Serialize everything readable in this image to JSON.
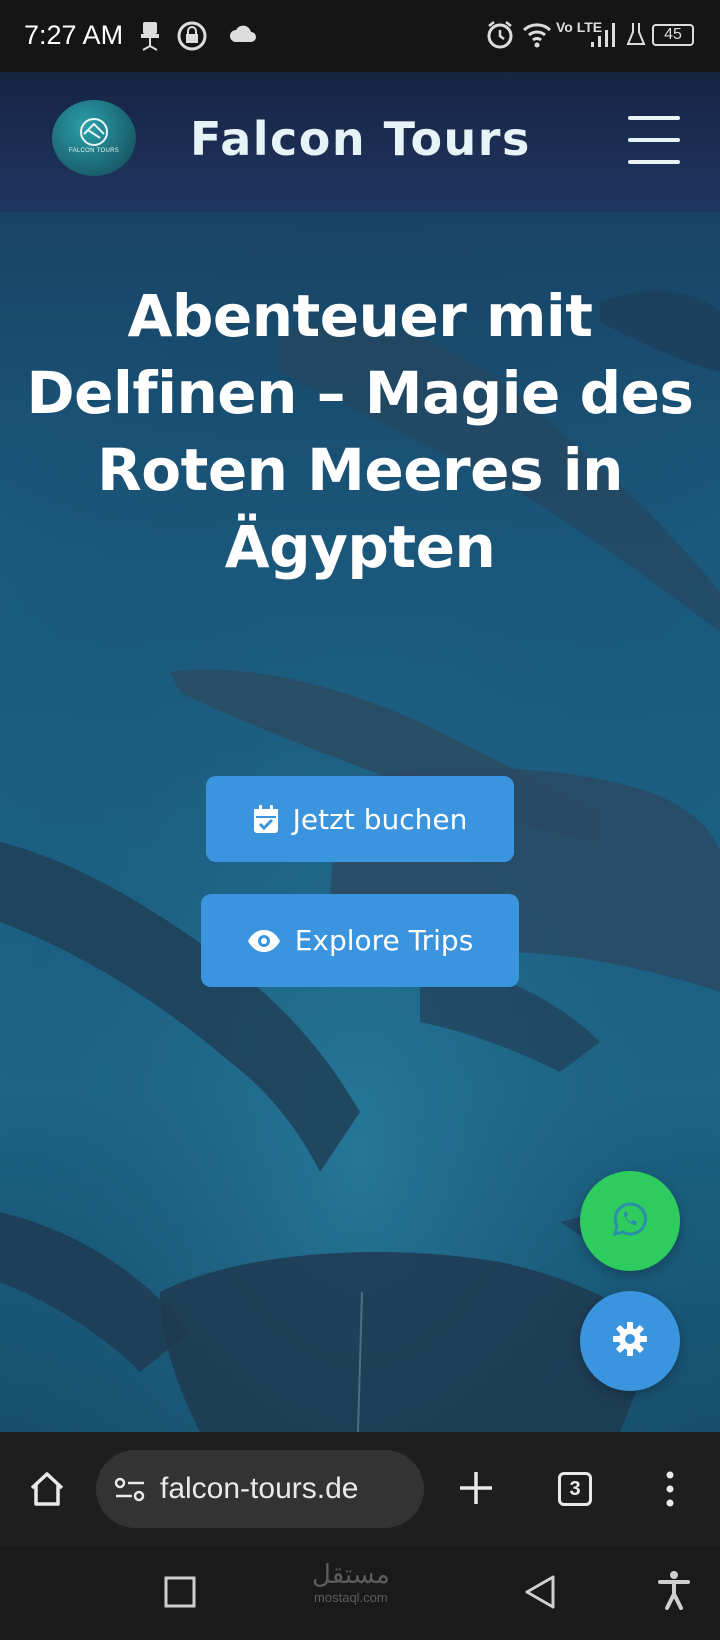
{
  "status_bar": {
    "time": "7:27 AM",
    "network": "Vo LTE",
    "battery": "45"
  },
  "header": {
    "logo_text": "FALCON TOURS",
    "brand": "Falcon Tours"
  },
  "hero": {
    "title": "Abenteuer mit Delfinen – Magie des Roten Meeres in Ägypten"
  },
  "buttons": {
    "book_label": "Jetzt buchen",
    "explore_label": "Explore Trips"
  },
  "browser": {
    "url": "falcon-tours.de",
    "tab_count": "3"
  },
  "watermark": {
    "arabic": "مستقل",
    "latin": "mostaql.com"
  },
  "colors": {
    "header_bg": "#1f3561",
    "button_blue": "#3a94de",
    "whatsapp_green": "#2ecc5f"
  },
  "icons": {
    "book_icon": "calendar-check-icon",
    "explore_icon": "eye-icon",
    "fab_1": "whatsapp-icon",
    "fab_2": "gear-icon"
  }
}
